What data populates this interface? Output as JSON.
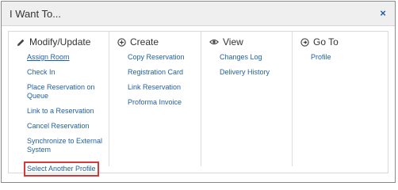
{
  "dialog": {
    "title": "I Want To...",
    "close_symbol": "×"
  },
  "columns": [
    {
      "header": "Modify/Update",
      "icon": "pencil-icon",
      "items": [
        "Assign Room",
        "Check In",
        "Place Reservation on Queue",
        "Link to a Reservation",
        "Cancel Reservation",
        "Synchronize to External System",
        "Select Another Profile"
      ]
    },
    {
      "header": "Create",
      "icon": "plus-circle-icon",
      "items": [
        "Copy Reservation",
        "Registration Card",
        "Link Reservation",
        "Proforma Invoice"
      ]
    },
    {
      "header": "View",
      "icon": "eye-icon",
      "items": [
        "Changes Log",
        "Delivery History"
      ]
    },
    {
      "header": "Go To",
      "icon": "arrow-circle-icon",
      "items": [
        "Profile"
      ]
    }
  ],
  "colors": {
    "link": "#1f5f9e",
    "highlight_border": "#d9383a",
    "title_bar": "#efefef"
  }
}
